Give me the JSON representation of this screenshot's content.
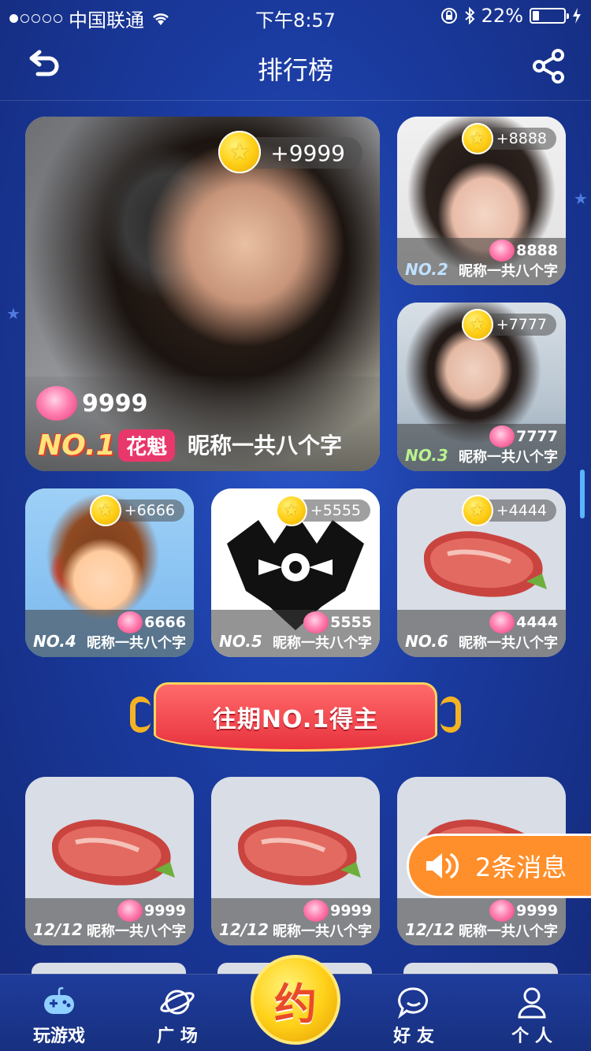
{
  "statusbar": {
    "carrier": "中国联通",
    "time": "下午8:57",
    "battery": "22%",
    "battery_level": 0.22
  },
  "nav": {
    "title": "排行榜"
  },
  "top1": {
    "coins": "+9999",
    "roses": "9999",
    "rank": "NO.1",
    "badge": "花魁",
    "nickname": "昵称一共八个字"
  },
  "rank_cards": [
    {
      "rank": "NO.2",
      "coins": "+8888",
      "roses": "8888",
      "nickname": "昵称一共八个字"
    },
    {
      "rank": "NO.3",
      "coins": "+7777",
      "roses": "7777",
      "nickname": "昵称一共八个字"
    },
    {
      "rank": "NO.4",
      "coins": "+6666",
      "roses": "6666",
      "nickname": "昵称一共八个字"
    },
    {
      "rank": "NO.5",
      "coins": "+5555",
      "roses": "5555",
      "nickname": "昵称一共八个字"
    },
    {
      "rank": "NO.6",
      "coins": "+4444",
      "roses": "4444",
      "nickname": "昵称一共八个字"
    }
  ],
  "past_winners": {
    "banner": "往期NO.1得主",
    "items": [
      {
        "date": "12/12",
        "roses": "9999",
        "nickname": "昵称一共八个字"
      },
      {
        "date": "12/12",
        "roses": "9999",
        "nickname": "昵称一共八个字"
      },
      {
        "date": "12/12",
        "roses": "9999",
        "nickname": "昵称一共八个字"
      }
    ]
  },
  "message_popup": {
    "label": "2条消息"
  },
  "tabbar": {
    "items": [
      {
        "label": "玩游戏"
      },
      {
        "label": "广 场"
      },
      {
        "label": "约"
      },
      {
        "label": "好 友"
      },
      {
        "label": "个 人"
      }
    ]
  },
  "colors": {
    "background": "#1a3a9e",
    "accent_orange": "#ff8f2b",
    "banner_red": "#e8333f",
    "coin_gold": "#ffd21a",
    "rose_pink": "#ff7fb1"
  }
}
